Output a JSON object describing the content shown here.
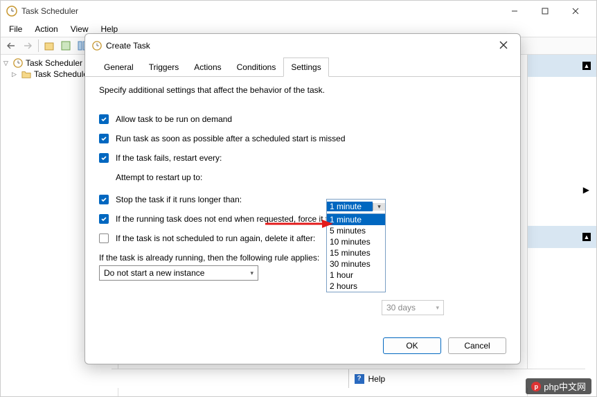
{
  "main_window": {
    "title": "Task Scheduler",
    "menu": {
      "file": "File",
      "action": "Action",
      "view": "View",
      "help": "Help"
    },
    "tree": {
      "root": "Task Scheduler (L",
      "child": "Task Schedule"
    },
    "help_label": "Help"
  },
  "dialog": {
    "title": "Create Task",
    "tabs": {
      "general": "General",
      "triggers": "Triggers",
      "actions": "Actions",
      "conditions": "Conditions",
      "settings": "Settings"
    },
    "description": "Specify additional settings that affect the behavior of the task.",
    "settings": {
      "allow_on_demand": "Allow task to be run on demand",
      "run_asap": "Run task as soon as possible after a scheduled start is missed",
      "restart_every": "If the task fails, restart every:",
      "attempt_up_to": "Attempt to restart up to:",
      "stop_longer": "Stop the task if it runs longer than:",
      "force_stop": "If the running task does not end when requested, force it to st",
      "delete_after": "If the task is not scheduled to run again, delete it after:",
      "already_running": "If the task is already running, then the following rule applies:"
    },
    "restart_dropdown": {
      "selected": "1 minute",
      "options": [
        "1 minute",
        "5 minutes",
        "10 minutes",
        "15 minutes",
        "30 minutes",
        "1 hour",
        "2 hours"
      ]
    },
    "delete_after_value": "30 days",
    "rule_value": "Do not start a new instance",
    "buttons": {
      "ok": "OK",
      "cancel": "Cancel"
    }
  },
  "watermark": "php中文网"
}
